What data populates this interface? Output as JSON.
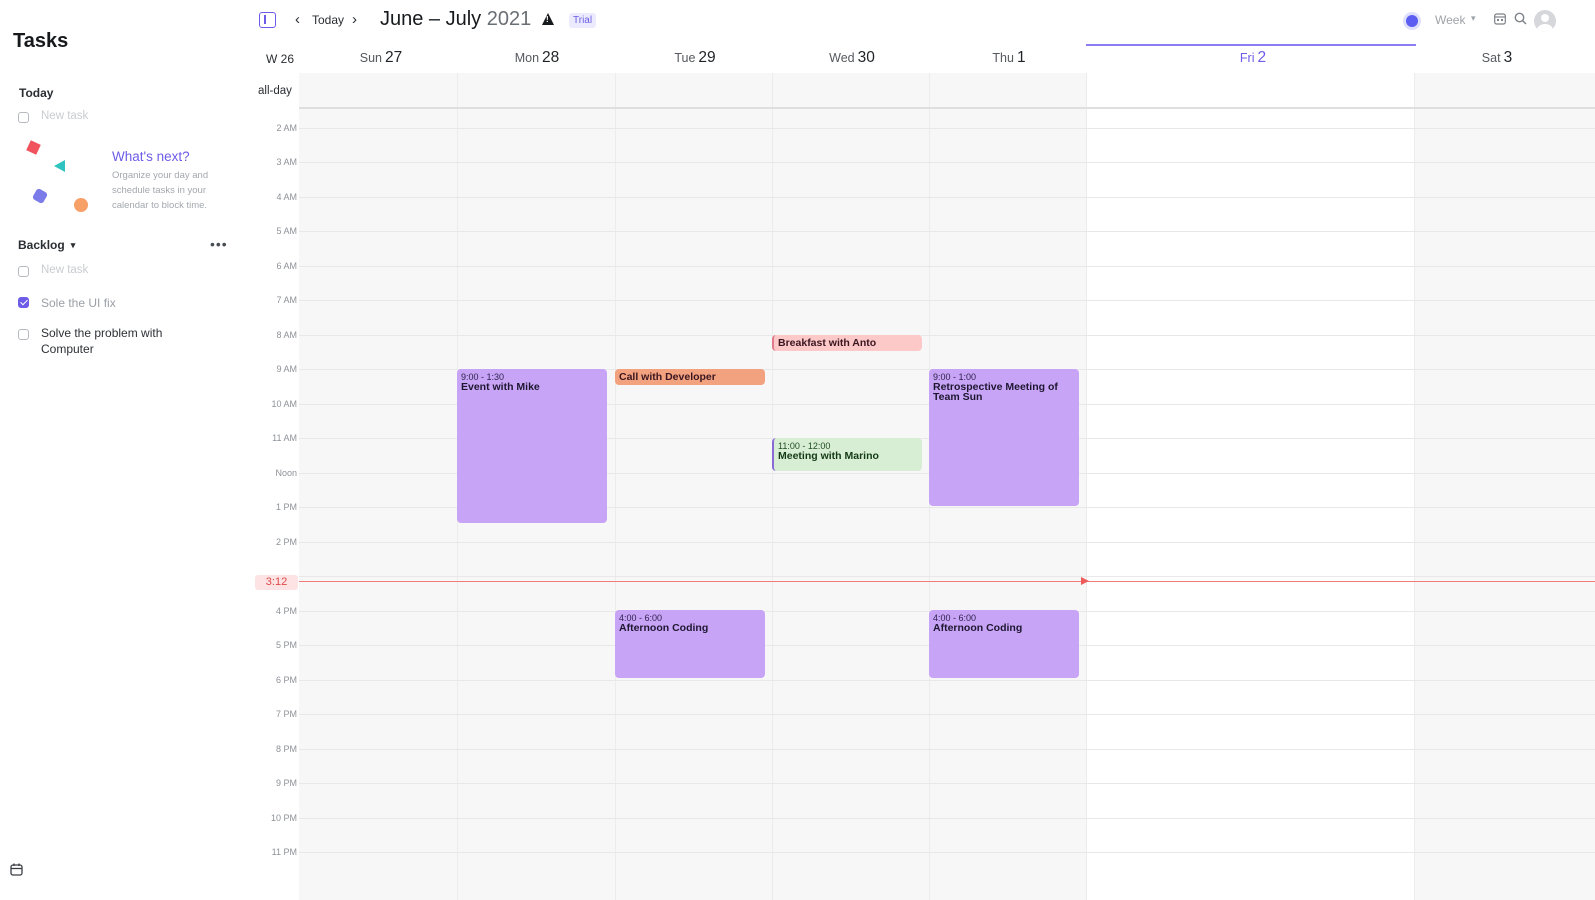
{
  "sidebar": {
    "title": "Tasks",
    "today_section": "Today",
    "new_task_placeholder": "New task",
    "whats_next_title": "What's next?",
    "whats_next_desc": "Organize your day and schedule tasks in your calendar to block time.",
    "backlog_section": "Backlog",
    "backlog_new_task_placeholder": "New task",
    "backlog_tasks": [
      {
        "label": "Sole the UI fix",
        "checked": true
      },
      {
        "label": "Solve the problem with Computer",
        "checked": false
      }
    ]
  },
  "topbar": {
    "today_label": "Today",
    "title_months": "June – July",
    "title_year": "2021",
    "trial_badge": "Trial",
    "view_label": "Week"
  },
  "calendar": {
    "week_label": "W 26",
    "allday_label": "all-day",
    "now_label": "3:12",
    "days": [
      {
        "name": "Sun",
        "num": "27"
      },
      {
        "name": "Mon",
        "num": "28"
      },
      {
        "name": "Tue",
        "num": "29"
      },
      {
        "name": "Wed",
        "num": "30"
      },
      {
        "name": "Thu",
        "num": "1"
      },
      {
        "name": "Fri",
        "num": "2"
      },
      {
        "name": "Sat",
        "num": "3"
      }
    ],
    "hours": [
      "2 AM",
      "3 AM",
      "4 AM",
      "5 AM",
      "6 AM",
      "7 AM",
      "8 AM",
      "9 AM",
      "10 AM",
      "11 AM",
      "Noon",
      "1 PM",
      "2 PM",
      "4 PM",
      "5 PM",
      "6 PM",
      "7 PM",
      "8 PM",
      "9 PM",
      "10 PM",
      "11 PM"
    ],
    "events": [
      {
        "time": "9:00 - 1:30",
        "title": "Event with Mike"
      },
      {
        "time": "",
        "title": "Call with Developer"
      },
      {
        "time": "",
        "title": "Breakfast with Anto"
      },
      {
        "time": "11:00 - 12:00",
        "title": "Meeting with Marino"
      },
      {
        "time": "9:00 - 1:00",
        "title": "Retrospective Meeting of Team Sun"
      },
      {
        "time": "4:00 - 6:00",
        "title": "Afternoon Coding"
      },
      {
        "time": "4:00 - 6:00",
        "title": "Afternoon Coding"
      }
    ]
  },
  "colors": {
    "accent": "#6c5ce7",
    "event_purple": "#c8a4f7",
    "event_pink": "#fcc8c8",
    "event_orange": "#f3a27f",
    "event_green": "#d7eed5",
    "now_line": "#ef5b5b"
  },
  "icons": [
    "sidebar-toggle-icon",
    "chevron-left-icon",
    "chevron-right-icon",
    "warning-icon",
    "status-dot-icon",
    "chevron-down-icon",
    "calendar-icon",
    "search-icon",
    "avatar-icon",
    "more-icon"
  ]
}
